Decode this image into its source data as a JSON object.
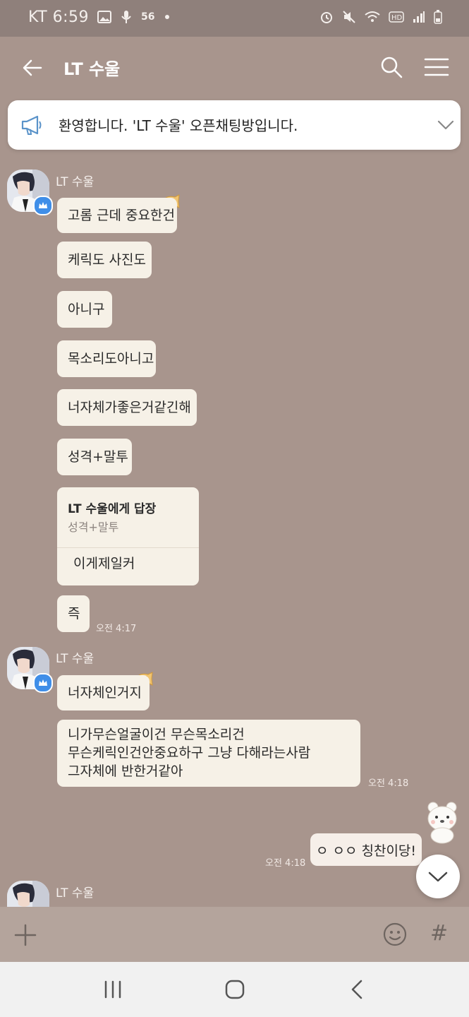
{
  "status_bar": {
    "carrier_time": "KT 6:59",
    "network": "56"
  },
  "header": {
    "title": "LT 수울"
  },
  "notice": {
    "text": "환영합니다. 'LT 수울' 오픈채팅방입니다."
  },
  "messages": {
    "group1": {
      "sender": "LT 수울",
      "bubbles": [
        "고롬 근데 중요한건",
        "케릭도 사진도",
        "아니구",
        "목소리도아니고",
        "너자체가좋은거같긴해",
        "성격+말투"
      ],
      "reply": {
        "title": "LT 수울에게 답장",
        "quote": "성격+말투",
        "text": "이게제일커"
      },
      "last": "즉",
      "time": "오전 4:17"
    },
    "group2": {
      "sender": "LT 수울",
      "bubble1": "너자체인거지",
      "lines": [
        "니가무슨얼굴이건 무슨목소리건",
        "무슨케릭인건안중요하구 그냥 다해라는사람",
        "그자체에 반한거같아"
      ],
      "time": "오전 4:18"
    },
    "mine": {
      "text": "ㅇ ㅇㅇ 칭찬이당!",
      "time": "오전 4:18"
    },
    "group3": {
      "sender": "LT 수울"
    }
  },
  "colors": {
    "chat_bg": "#a8958d",
    "bubble": "#f6f1e7",
    "badge": "#3f8ee8"
  },
  "icons": {
    "status_left": [
      "image-icon",
      "mic-icon",
      "network-icon",
      "dot-icon"
    ],
    "status_right": [
      "alarm-icon",
      "mute-icon",
      "wifi-icon",
      "hd-icon",
      "signal-icon",
      "battery-icon"
    ],
    "header": [
      "back-arrow-icon",
      "search-icon",
      "menu-icon"
    ],
    "input": [
      "plus-icon",
      "emoji-icon",
      "hash-icon"
    ]
  }
}
